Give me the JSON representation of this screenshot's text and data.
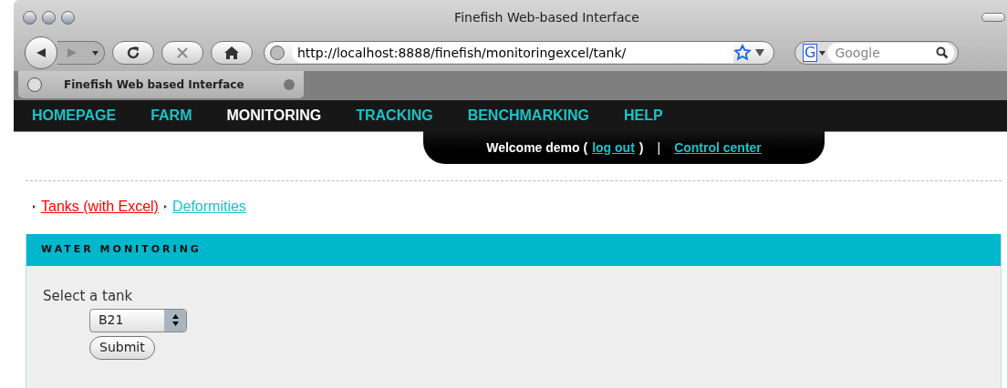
{
  "window": {
    "title": "Finefish Web-based Interface"
  },
  "toolbar": {
    "url": "http://localhost:8888/finefish/monitoringexcel/tank/",
    "search_placeholder": "Google",
    "search_engine": "G"
  },
  "tab": {
    "title": "Finefish Web  based Interface"
  },
  "nav": [
    {
      "label": "HOMEPAGE",
      "selected": false
    },
    {
      "label": "FARM",
      "selected": false
    },
    {
      "label": "MONITORING",
      "selected": true
    },
    {
      "label": "TRACKING",
      "selected": false
    },
    {
      "label": "BENCHMARKING",
      "selected": false
    },
    {
      "label": "HELP",
      "selected": false
    }
  ],
  "user_bar": {
    "welcome": "Welcome demo (",
    "logout": "log out",
    "close": ")",
    "separator": "|",
    "control_center": "Control center"
  },
  "sub_links": [
    {
      "label": "Tanks (with Excel)",
      "selected": true
    },
    {
      "label": "Deformities",
      "selected": false
    }
  ],
  "panel": {
    "title": "WATER MONITORING",
    "label": "Select a tank",
    "tank": "B21",
    "submit": "Submit"
  }
}
